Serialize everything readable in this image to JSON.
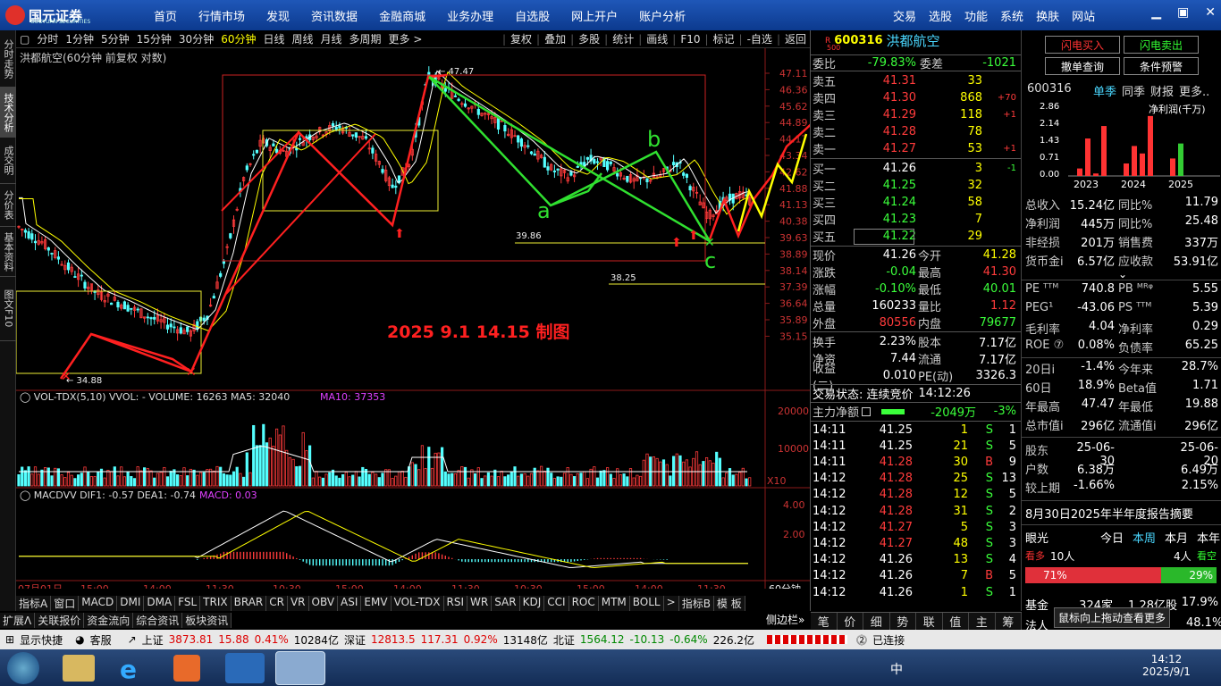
{
  "app": {
    "logo_text": "国元证券",
    "logo_sub": "GUOYUAN SECURITIES"
  },
  "topnav": [
    "首页",
    "行情市场",
    "发现",
    "资讯数据",
    "金融商城",
    "业务办理",
    "自选股",
    "网上开户",
    "账户分析"
  ],
  "topright": [
    "交易",
    "选股",
    "功能",
    "系统",
    "换肤",
    "网站"
  ],
  "sidetabs": [
    "分时走势",
    "技术分析",
    "成交明细",
    "分价表",
    "基本资料",
    "图文F10"
  ],
  "toolbar": [
    "分时",
    "1分钟",
    "5分钟",
    "15分钟",
    "30分钟",
    "60分钟",
    "日线",
    "周线",
    "月线",
    "多周期",
    "更多 >"
  ],
  "toolbar_right": [
    "复权",
    "叠加",
    "多股",
    "统计",
    "画线",
    "F10",
    "标记",
    "-自选",
    "返回"
  ],
  "chart": {
    "title": "洪都航空(60分钟 前复权 对数)",
    "annotation": "2025  9.1   14.15  制图",
    "price_ticks": [
      "47.11",
      "46.36",
      "45.62",
      "44.89",
      "44.17",
      "43.34",
      "42.62",
      "41.88",
      "41.13",
      "40.38",
      "39.63",
      "38.89",
      "38.14",
      "37.39",
      "36.64",
      "35.89",
      "35.15"
    ],
    "labels": {
      "high": "47.47",
      "low": "34.88",
      "l1": "39.86",
      "l2": "38.25"
    },
    "wave_labels": [
      "a",
      "b",
      "c"
    ]
  },
  "vol": {
    "title": "VOL-TDX(5,10) VVOL: - VOLUME: 16263 MA5: 32040",
    "ma10": "MA10: 37353",
    "ticks": [
      "20000",
      "10000"
    ],
    "mult": "X10"
  },
  "macd": {
    "title": "MACDVV DIF1: -0.57 DEA1: -0.74",
    "macd": "MACD: 0.03",
    "ticks": [
      "4.00",
      "2.00"
    ]
  },
  "xaxis": [
    "07月01日",
    "15:00",
    "14:00",
    "11:30",
    "10:30",
    "15:00",
    "14:00",
    "11:30",
    "10:30",
    "15:00",
    "14:00",
    "11:30"
  ],
  "period_label": "60分钟",
  "indtabs": [
    "指标A",
    "窗口",
    "MACD",
    "DMI",
    "DMA",
    "FSL",
    "TRIX",
    "BRAR",
    "CR",
    "VR",
    "OBV",
    "ASI",
    "EMV",
    "VOL-TDX",
    "RSI",
    "WR",
    "SAR",
    "KDJ",
    "CCI",
    "ROC",
    "MTM",
    "BOLL",
    ">",
    "指标B",
    "模 板"
  ],
  "bottomtabs": [
    "扩展ᐱ",
    "关联报价",
    "资金流向",
    "综合资讯",
    "板块资讯"
  ],
  "stock": {
    "code": "600316",
    "name": "洪都航空",
    "r_label": "R",
    "r_num": "500"
  },
  "book": {
    "weibi_label": "委比",
    "weibi": "-79.83%",
    "weicha_label": "委差",
    "weicha": "-1021",
    "asks": [
      {
        "l": "卖五",
        "p": "41.31",
        "v": "33",
        "d": ""
      },
      {
        "l": "卖四",
        "p": "41.30",
        "v": "868",
        "d": "+70"
      },
      {
        "l": "卖三",
        "p": "41.29",
        "v": "118",
        "d": "+1"
      },
      {
        "l": "卖二",
        "p": "41.28",
        "v": "78",
        "d": ""
      },
      {
        "l": "卖一",
        "p": "41.27",
        "v": "53",
        "d": "+1"
      }
    ],
    "bids": [
      {
        "l": "买一",
        "p": "41.26",
        "v": "3",
        "d": "-1"
      },
      {
        "l": "买二",
        "p": "41.25",
        "v": "32",
        "d": ""
      },
      {
        "l": "买三",
        "p": "41.24",
        "v": "58",
        "d": ""
      },
      {
        "l": "买四",
        "p": "41.23",
        "v": "7",
        "d": ""
      },
      {
        "l": "买五",
        "p": "41.22",
        "v": "29",
        "d": ""
      }
    ]
  },
  "quote": [
    {
      "a": "现价",
      "av": "41.26",
      "b": "今开",
      "bv": "41.28"
    },
    {
      "a": "涨跌",
      "av": "-0.04",
      "b": "最高",
      "bv": "41.30"
    },
    {
      "a": "涨幅",
      "av": "-0.10%",
      "b": "最低",
      "bv": "40.01"
    },
    {
      "a": "总量",
      "av": "160233",
      "b": "量比",
      "bv": "1.12"
    },
    {
      "a": "外盘",
      "av": "80556",
      "b": "内盘",
      "bv": "79677"
    },
    {
      "a": "换手",
      "av": "2.23%",
      "b": "股本",
      "bv": "7.17亿"
    },
    {
      "a": "净资",
      "av": "7.44",
      "b": "流通",
      "bv": "7.17亿"
    },
    {
      "a": "收益(二)",
      "av": "0.010",
      "b": "PE(动)",
      "bv": "3326.3"
    }
  ],
  "trade_state": {
    "label": "交易状态: 连续竞价",
    "time": "14:12:26"
  },
  "mainflow": {
    "label": "主力净额",
    "value": "-2049万",
    "pct": "-3%"
  },
  "ticks": [
    {
      "t": "14:11",
      "p": "41.25",
      "v": "1",
      "s": "S",
      "n": "1"
    },
    {
      "t": "14:11",
      "p": "41.25",
      "v": "21",
      "s": "S",
      "n": "5"
    },
    {
      "t": "14:11",
      "p": "41.28",
      "v": "30",
      "s": "B",
      "n": "9"
    },
    {
      "t": "14:12",
      "p": "41.28",
      "v": "25",
      "s": "S",
      "n": "13"
    },
    {
      "t": "14:12",
      "p": "41.28",
      "v": "12",
      "s": "S",
      "n": "5"
    },
    {
      "t": "14:12",
      "p": "41.28",
      "v": "31",
      "s": "S",
      "n": "2"
    },
    {
      "t": "14:12",
      "p": "41.27",
      "v": "5",
      "s": "S",
      "n": "3"
    },
    {
      "t": "14:12",
      "p": "41.27",
      "v": "48",
      "s": "S",
      "n": "3"
    },
    {
      "t": "14:12",
      "p": "41.26",
      "v": "13",
      "s": "S",
      "n": "4"
    },
    {
      "t": "14:12",
      "p": "41.26",
      "v": "7",
      "s": "B",
      "n": "5"
    },
    {
      "t": "14:12",
      "p": "41.26",
      "v": "1",
      "s": "S",
      "n": "1"
    }
  ],
  "rtabs": [
    "笔",
    "价",
    "细",
    "势",
    "联",
    "值",
    "主",
    "筹"
  ],
  "far": {
    "btns": [
      "闪电买入",
      "闪电卖出",
      "撤单查询",
      "条件预警"
    ],
    "code": "600316",
    "tabs": [
      "单季",
      "同季",
      "财报",
      "更多.."
    ],
    "fin_label": "净利润(千万)",
    "fin_ticks": [
      "2.86",
      "2.14",
      "1.43",
      "0.71",
      "0.00"
    ],
    "fin_years": [
      "2023",
      "2024",
      "2025"
    ],
    "fin_bars": [
      {
        "year": "2023",
        "v": [
          0.3,
          1.5,
          0.1,
          2.0
        ]
      },
      {
        "year": "2024",
        "v": [
          0.5,
          1.2,
          0.9,
          2.4
        ]
      },
      {
        "year": "2025",
        "v": [
          0.7,
          1.3
        ]
      }
    ],
    "rows": [
      {
        "a": "总收入",
        "av": "15.24亿",
        "b": "同比%",
        "bv": "11.79"
      },
      {
        "a": "净利润",
        "av": "445万",
        "b": "同比%",
        "bv": "25.48"
      },
      {
        "a": "非经损",
        "av": "201万",
        "b": "销售费",
        "bv": "337万"
      },
      {
        "a": "货币金i",
        "av": "6.57亿",
        "b": "应收款",
        "bv": "53.91亿"
      }
    ],
    "rows2": [
      {
        "a": "PE ᵀᵀᴹ",
        "av": "740.8",
        "b": "PB ᴹᴿᵠ",
        "bv": "5.55"
      },
      {
        "a": "PEG¹",
        "av": "-43.06",
        "b": "PS ᵀᵀᴹ",
        "bv": "5.39"
      },
      {
        "a": "毛利率",
        "av": "4.04",
        "b": "净利率",
        "bv": "0.29"
      },
      {
        "a": "ROE ⑦",
        "av": "0.08%",
        "b": "负债率",
        "bv": "65.25"
      }
    ],
    "rows3": [
      {
        "a": "20日i",
        "av": "-1.4%",
        "b": "今年来",
        "bv": "28.7%"
      },
      {
        "a": "60日",
        "av": "18.9%",
        "b": "Beta值",
        "bv": "1.71"
      },
      {
        "a": "年最高",
        "av": "47.47",
        "b": "年最低",
        "bv": "19.88"
      },
      {
        "a": "总市值i",
        "av": "296亿",
        "b": "流通值i",
        "bv": "296亿"
      }
    ],
    "rows4": [
      {
        "a": "股东",
        "av": "25-06-30",
        "b": "",
        "bv": "25-06-20"
      },
      {
        "a": "户数",
        "av": "6.38万",
        "b": "",
        "bv": "6.49万"
      },
      {
        "a": "较上期",
        "av": "-1.66%",
        "b": "",
        "bv": "2.15%"
      }
    ],
    "report": "8月30日2025年半年度报告摘要",
    "eye": "眼光",
    "eye_tabs": [
      "今日",
      "本周",
      "本月",
      "本年"
    ],
    "bull": "看多",
    "bull_n": "10人",
    "bear_n": "4人",
    "bear": "看空",
    "bull_pct": "71%",
    "bear_pct": "29%",
    "fund_label": "基金",
    "fund_n": "324家",
    "fund_v": "1.28亿股",
    "fund_p": "17.9%",
    "inst_label": "法人",
    "inst_p": "48.1%",
    "hint": "鼠标向上拖动查看更多",
    "sidebar_btn": "侧边栏»"
  },
  "status": {
    "show": "显示快捷",
    "service": "客服",
    "sh_label": "上证",
    "sh": "3873.81",
    "sh_c": "15.88",
    "sh_p": "0.41%",
    "sh_amt": "10284亿",
    "sz_label": "深证",
    "sz": "12813.5",
    "sz_c": "117.31",
    "sz_p": "0.92%",
    "sz_amt": "13148亿",
    "bz_label": "北证",
    "bz": "1564.12",
    "bz_c": "-10.13",
    "bz_p": "-0.64%",
    "bz_amt": "226.2亿",
    "conn": "已连接"
  },
  "taskbar": {
    "time": "14:12",
    "date": "2025/9/1",
    "ime": "中"
  }
}
